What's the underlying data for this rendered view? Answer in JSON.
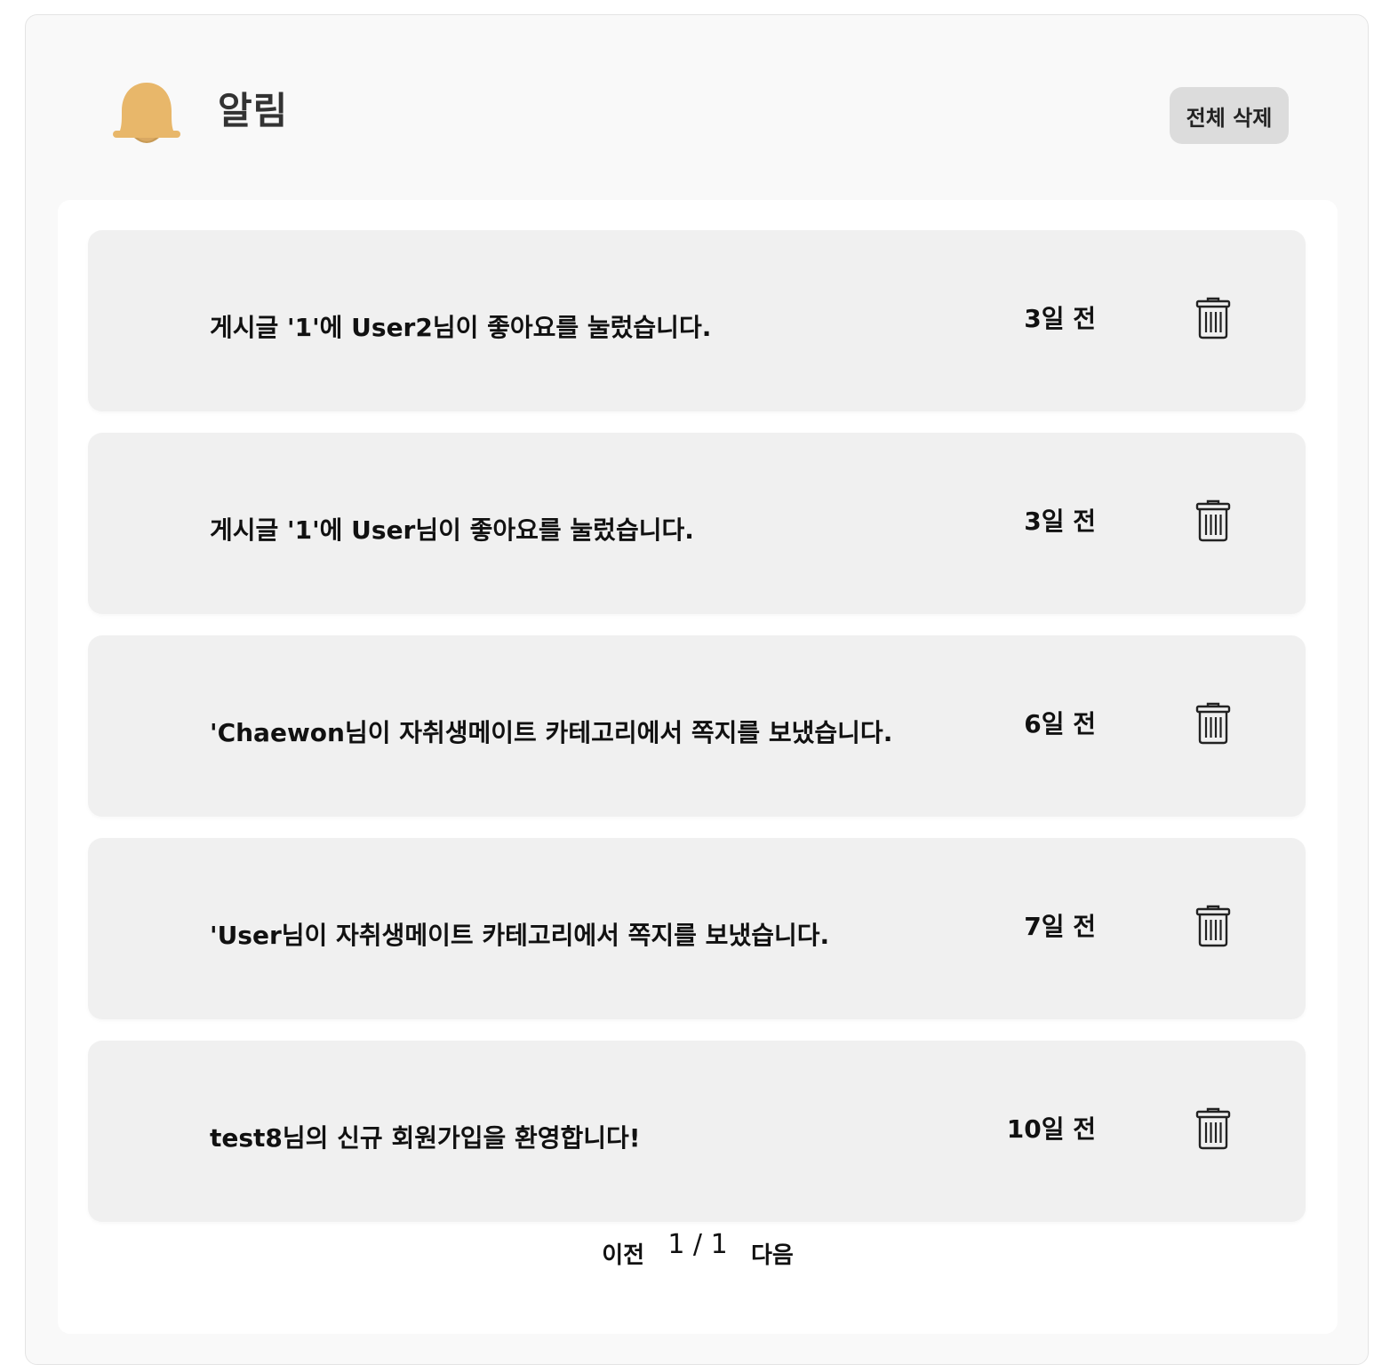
{
  "header": {
    "title": "알림",
    "delete_all_label": "전체 삭제",
    "bell_icon": "bell-icon",
    "bell_color": "#E8B76A"
  },
  "notifications": [
    {
      "message": "게시글 '1'에 User2님이 좋아요를 눌렀습니다.",
      "time": "3일 전"
    },
    {
      "message": "게시글 '1'에 User님이 좋아요를 눌렀습니다.",
      "time": "3일 전"
    },
    {
      "message": "'Chaewon님이 자취생메이트 카테고리에서 쪽지를 보냈습니다.",
      "time": "6일 전"
    },
    {
      "message": "'User님이 자취생메이트 카테고리에서 쪽지를 보냈습니다.",
      "time": "7일 전"
    },
    {
      "message": "test8님의 신규 회원가입을 환영합니다!",
      "time": "10일 전"
    }
  ],
  "pagination": {
    "prev_label": "이전",
    "page_indicator": "1 / 1",
    "next_label": "다음"
  }
}
